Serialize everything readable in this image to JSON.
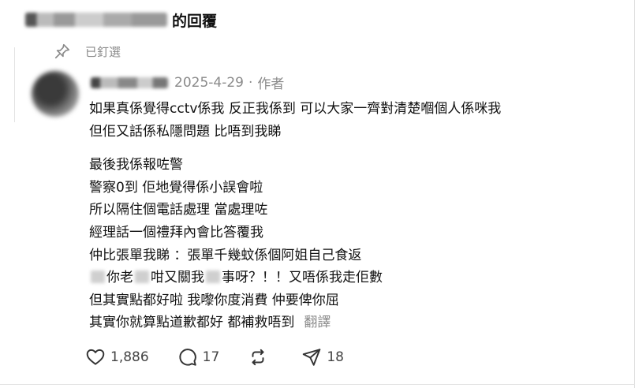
{
  "header": {
    "title": "的回覆"
  },
  "pinned": {
    "label": "已釘選"
  },
  "post": {
    "date": "2025-4-29",
    "separator": "·",
    "author_badge": "作者",
    "paragraph1": [
      "如果真係覺得cctv係我 反正我係到 可以大家一齊對清楚嗰個人係咪我",
      "但佢又話係私隱問題 比唔到我睇"
    ],
    "paragraph2": [
      "最後我係報咗警",
      "警察0到 佢地覺得係小誤會啦",
      "所以隔住個電話處理 當處理咗",
      "經理話一個禮拜內會比答覆我",
      "仲比張單我睇 ：張單千幾蚊係個阿姐自己食返"
    ],
    "line_censored": {
      "a": "你老",
      "b": "咁又關我",
      "c": "事呀？！！又唔係我走佢數"
    },
    "paragraph2_end": [
      "但其實點都好啦 我嚟你度消費 仲要俾你屈",
      "其實你就算點道歉都好 都補救唔到"
    ],
    "translate_label": "翻譯"
  },
  "actions": {
    "likes": "1,886",
    "comments": "17",
    "shares": "18"
  }
}
